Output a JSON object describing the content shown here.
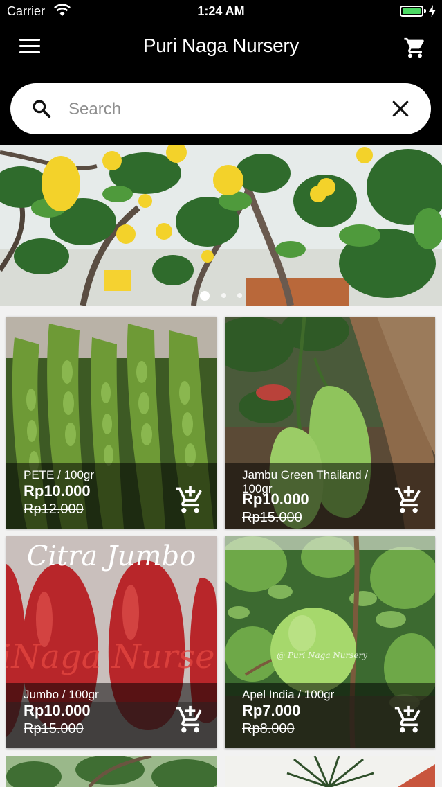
{
  "status_bar": {
    "carrier": "Carrier",
    "time": "1:24 AM",
    "battery_level": 1.0
  },
  "header": {
    "title": "Puri Naga Nursery",
    "menu_icon": "hamburger-menu-icon",
    "cart_icon": "shopping-cart-icon"
  },
  "search": {
    "placeholder": "Search",
    "value": ""
  },
  "banner": {
    "slide_count": 3,
    "active_slide": 1
  },
  "products": [
    {
      "name": "PETE / 100gr",
      "price": "Rp10.000",
      "old_price": "Rp12.000"
    },
    {
      "name": "Jambu Green Thailand / 100gr",
      "price": "Rp10.000",
      "old_price": "Rp15.000"
    },
    {
      "name": "Jumbo / 100gr",
      "price": "Rp10.000",
      "old_price": "Rp15.000"
    },
    {
      "name": "Apel India / 100gr",
      "price": "Rp7.000",
      "old_price": "Rp8.000"
    }
  ],
  "product_photo_text": {
    "jumbo_watermark_top": "Citra Jumbo",
    "jumbo_watermark_mid": "iNaga Nurse",
    "apel_watermark": "@ Puri Naga Nursery"
  },
  "colors": {
    "header_bg": "#000000",
    "battery": "#4cd964",
    "page_bg": "#f2f2f2"
  }
}
